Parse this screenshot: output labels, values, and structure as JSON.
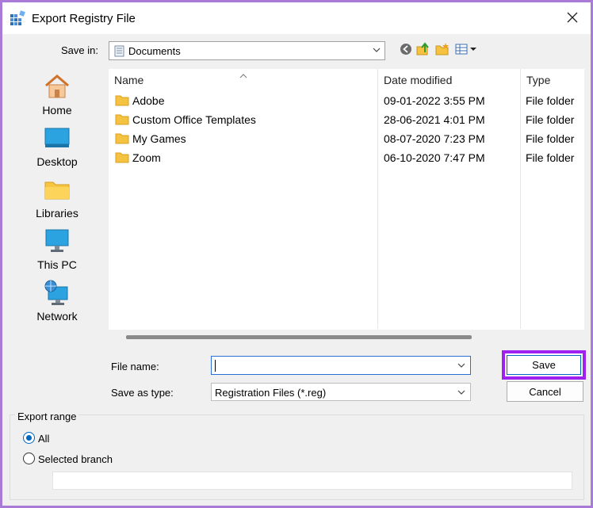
{
  "window": {
    "title": "Export Registry File",
    "icons": {
      "app": "registry-icon",
      "close": "close-icon"
    }
  },
  "save_in": {
    "label": "Save in:",
    "value": "Documents",
    "icon": "documents-folder-icon"
  },
  "toolbar": {
    "icons": [
      "back-icon",
      "up-folder-icon",
      "new-folder-icon",
      "view-menu-icon"
    ]
  },
  "places": [
    {
      "label": "Home",
      "icon": "home-icon"
    },
    {
      "label": "Desktop",
      "icon": "desktop-icon"
    },
    {
      "label": "Libraries",
      "icon": "libraries-icon"
    },
    {
      "label": "This PC",
      "icon": "this-pc-icon"
    },
    {
      "label": "Network",
      "icon": "network-icon"
    }
  ],
  "file_list": {
    "columns": [
      "Name",
      "Date modified",
      "Type"
    ],
    "rows": [
      {
        "name": "Adobe",
        "date": "09-01-2022 3:55 PM",
        "type": "File folder"
      },
      {
        "name": "Custom Office Templates",
        "date": "28-06-2021 4:01 PM",
        "type": "File folder"
      },
      {
        "name": "My Games",
        "date": "08-07-2020 7:23 PM",
        "type": "File folder"
      },
      {
        "name": "Zoom",
        "date": "06-10-2020 7:47 PM",
        "type": "File folder"
      }
    ]
  },
  "form": {
    "file_name_label": "File name:",
    "file_name_value": "",
    "save_type_label": "Save as type:",
    "save_type_value": "Registration Files (*.reg)"
  },
  "buttons": {
    "save": "Save",
    "cancel": "Cancel"
  },
  "export_range": {
    "legend": "Export range",
    "all_label": "All",
    "branch_label": "Selected branch",
    "selected": "All",
    "branch_value": ""
  },
  "colors": {
    "frame_border": "#a97bd7",
    "highlight_border": "#a020f0",
    "accent": "#0067c0",
    "folder": "#f5c242"
  }
}
